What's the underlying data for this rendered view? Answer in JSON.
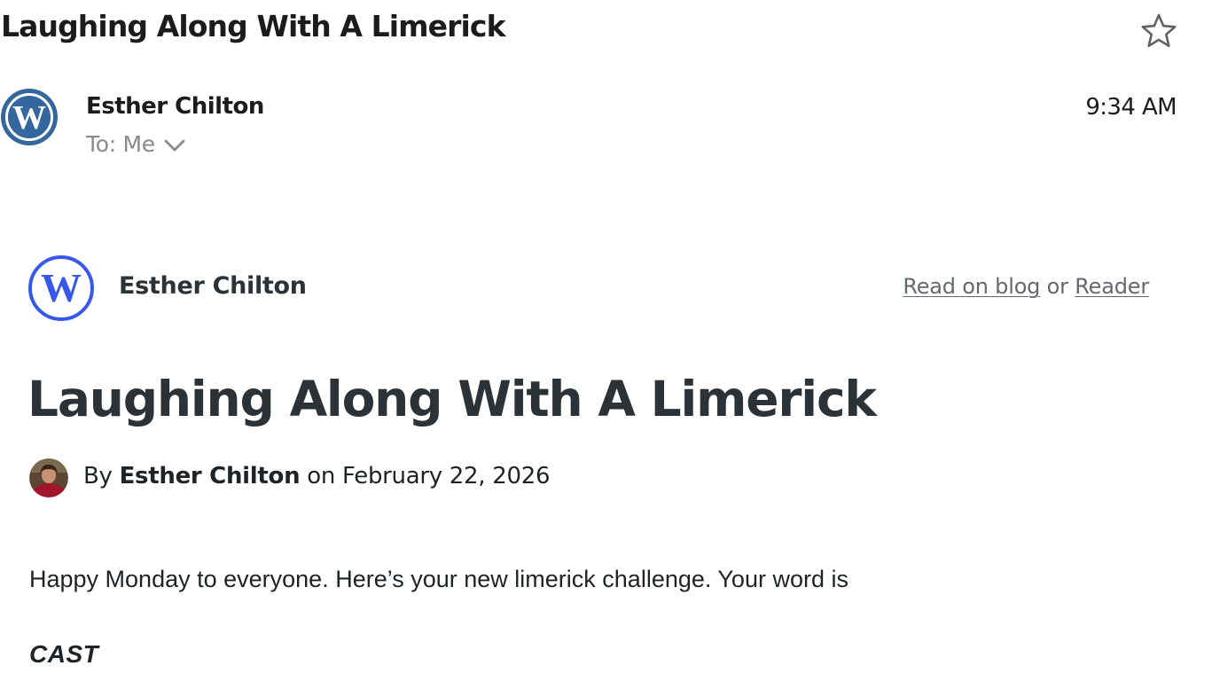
{
  "message": {
    "subject": "Laughing Along With A Limerick",
    "sender_name": "Esther Chilton",
    "recipients": "To: Me",
    "time": "9:34 AM",
    "starred": false
  },
  "icons": {
    "star": "star-outline-icon",
    "sender_avatar": "wordpress-logo-icon",
    "recipients_toggle": "chevron-down-icon",
    "blog_logo": "wordpress-logo-icon",
    "author_avatar": "author-photo"
  },
  "colors": {
    "sender_logo": "#34679d",
    "blog_logo": "#3858e9",
    "link_gray": "#646970",
    "title_text": "#2c3338"
  },
  "email_body": {
    "blog_name": "Esther Chilton",
    "read_on_blog_label": "Read on blog",
    "or_label": "or",
    "reader_label": "Reader",
    "post_title": "Laughing Along With A Limerick",
    "byline": {
      "by_label": "By",
      "author": "Esther Chilton",
      "on_label": "on",
      "date": "February 22, 2026"
    },
    "paragraph": "Happy Monday to everyone. Here’s your new limerick challenge. Your word is",
    "challenge_word": "CAST"
  }
}
